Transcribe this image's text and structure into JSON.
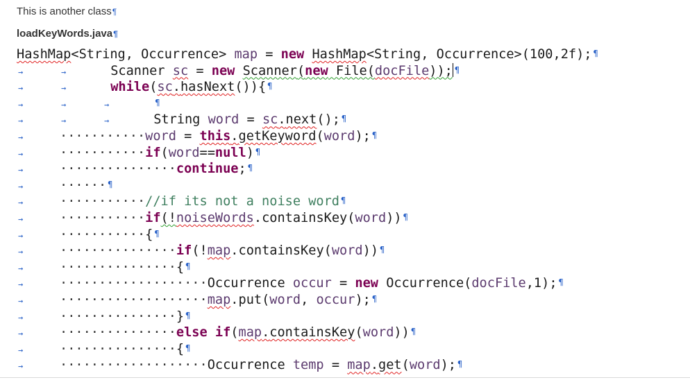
{
  "doc": {
    "title_text": "This is another class",
    "file_name": "loadKeyWords.java",
    "pilcrow": "¶",
    "code": {
      "l1": {
        "t1": "HashMap",
        "t2": "<String, Occurrence> ",
        "t3": "map",
        "t4": " = ",
        "t5": "new",
        "t6": " ",
        "t7": "HashMap",
        "t8": "<String, Occurrence>(100,2f);"
      },
      "l2": {
        "t1": " ",
        "t2": "Scanner",
        "t3": " ",
        "t4": "sc",
        "t5": " = ",
        "t6": "new",
        "t7": " ",
        "t8": "Scanner",
        "t9": "(",
        "t10": "new",
        "t11": " File(",
        "t12": "docFile",
        "t13": "));"
      },
      "l3": {
        "t1": " ",
        "t2": "while",
        "t3": "(",
        "t4": "sc",
        "t5": ".",
        "t6": "hasNext",
        "t7": "()){"
      },
      "l4": {
        "t1": " "
      },
      "l5": {
        "t1": " String ",
        "t2": "word",
        "t3": " = ",
        "t4": "sc",
        "t5": ".",
        "t6": "next",
        "t7": "();"
      },
      "l6": {
        "d": "···········",
        "t1": "word",
        "t2": " = ",
        "t3": "this",
        "t4": ".",
        "t5": "getKeyword",
        "t6": "(",
        "t7": "word",
        "t8": ");"
      },
      "l7": {
        "d": "···········",
        "t1": "if",
        "t2": "(",
        "t3": "word",
        "t4": "==",
        "t5": "null",
        "t6": ")"
      },
      "l8": {
        "d": "···············",
        "t1": "continue",
        "t2": ";"
      },
      "l9": {
        "d": "······"
      },
      "l10": {
        "d": "···········",
        "t1": "//if its not a noise word"
      },
      "l11": {
        "d": "···········",
        "t1": "if",
        "t2": "(!",
        "t3": "noiseWords",
        "t4": ".",
        "t5": "containsKey",
        "t6": "(",
        "t7": "word",
        "t8": "))"
      },
      "l12": {
        "d": "···········",
        "t1": "{"
      },
      "l13": {
        "d": "···············",
        "t1": "if",
        "t2": "(!",
        "t3": "map",
        "t4": ".",
        "t5": "containsKey",
        "t6": "(",
        "t7": "word",
        "t8": "))"
      },
      "l14": {
        "d": "···············",
        "t1": "{"
      },
      "l15": {
        "d": "···················",
        "t1": "Occurrence ",
        "t2": "occur",
        "t3": " = ",
        "t4": "new",
        "t5": " Occurrence(",
        "t6": "docFile",
        "t7": ",1);"
      },
      "l16": {
        "d": "···················",
        "t1": "map",
        "t2": ".",
        "t3": "put",
        "t4": "(",
        "t5": "word",
        "t6": ", ",
        "t7": "occur",
        "t8": ");"
      },
      "l17": {
        "d": "···············",
        "t1": "}"
      },
      "l18": {
        "d": "···············",
        "t1": "else",
        "t2": " ",
        "t3": "if",
        "t4": "(",
        "t5": "map",
        "t6": ".",
        "t7": "containsKey",
        "t8": "(",
        "t9": "word",
        "t10": "))"
      },
      "l19": {
        "d": "···············",
        "t1": "{"
      },
      "l20": {
        "d": "···················",
        "t1": "Occurrence ",
        "t2": "temp",
        "t3": " = ",
        "t4": "map",
        "t5": ".",
        "t6": "get",
        "t7": "(",
        "t8": "word",
        "t9": ");"
      }
    }
  },
  "colors": {
    "keyword": "#7b0052",
    "variable": "#5b3a6e",
    "comment": "#3f7f5f",
    "formatting_marks": "#2a62c8",
    "error_underline": "#e02020",
    "warning_underline": "#2e9e2e"
  }
}
